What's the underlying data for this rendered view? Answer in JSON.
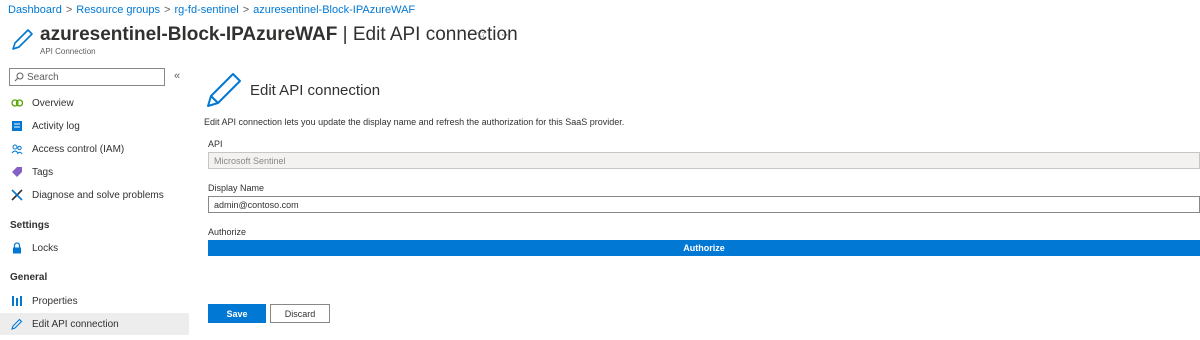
{
  "breadcrumb": {
    "items": [
      "Dashboard",
      "Resource groups",
      "rg-fd-sentinel",
      "azuresentinel-Block-IPAzureWAF"
    ],
    "separator": ">"
  },
  "header": {
    "resource_name": "azuresentinel-Block-IPAzureWAF",
    "page_suffix": " | Edit API connection",
    "subtitle": "API Connection",
    "star_icon": "star",
    "more_icon": "ellipsis"
  },
  "sidebar": {
    "search_placeholder": "Search",
    "collapse_glyph": "«",
    "items": [
      {
        "label": "Overview",
        "icon": "overview-icon",
        "color": "#57a300"
      },
      {
        "label": "Activity log",
        "icon": "activity-log-icon",
        "color": "#0078d4"
      },
      {
        "label": "Access control (IAM)",
        "icon": "people-icon",
        "color": "#0078d4"
      },
      {
        "label": "Tags",
        "icon": "tag-icon",
        "color": "#8661c5"
      },
      {
        "label": "Diagnose and solve problems",
        "icon": "wrench-icon",
        "color": "#323130"
      }
    ],
    "section_settings": "Settings",
    "settings_items": [
      {
        "label": "Locks",
        "icon": "lock-icon",
        "color": "#0078d4"
      }
    ],
    "section_general": "General",
    "general_items": [
      {
        "label": "Properties",
        "icon": "properties-icon",
        "color": "#0078d4"
      },
      {
        "label": "Edit API connection",
        "icon": "pencil-icon",
        "color": "#0078d4"
      }
    ]
  },
  "content": {
    "title": "Edit API connection",
    "description": "Edit API connection lets you update the display name and refresh the authorization for this SaaS provider.",
    "api_label": "API",
    "api_value": "Microsoft Sentinel",
    "display_name_label": "Display Name",
    "display_name_value": "admin@contoso.com",
    "authorize_label": "Authorize",
    "authorize_button": "Authorize",
    "save_button": "Save",
    "discard_button": "Discard"
  },
  "colors": {
    "accent": "#0078d4"
  }
}
